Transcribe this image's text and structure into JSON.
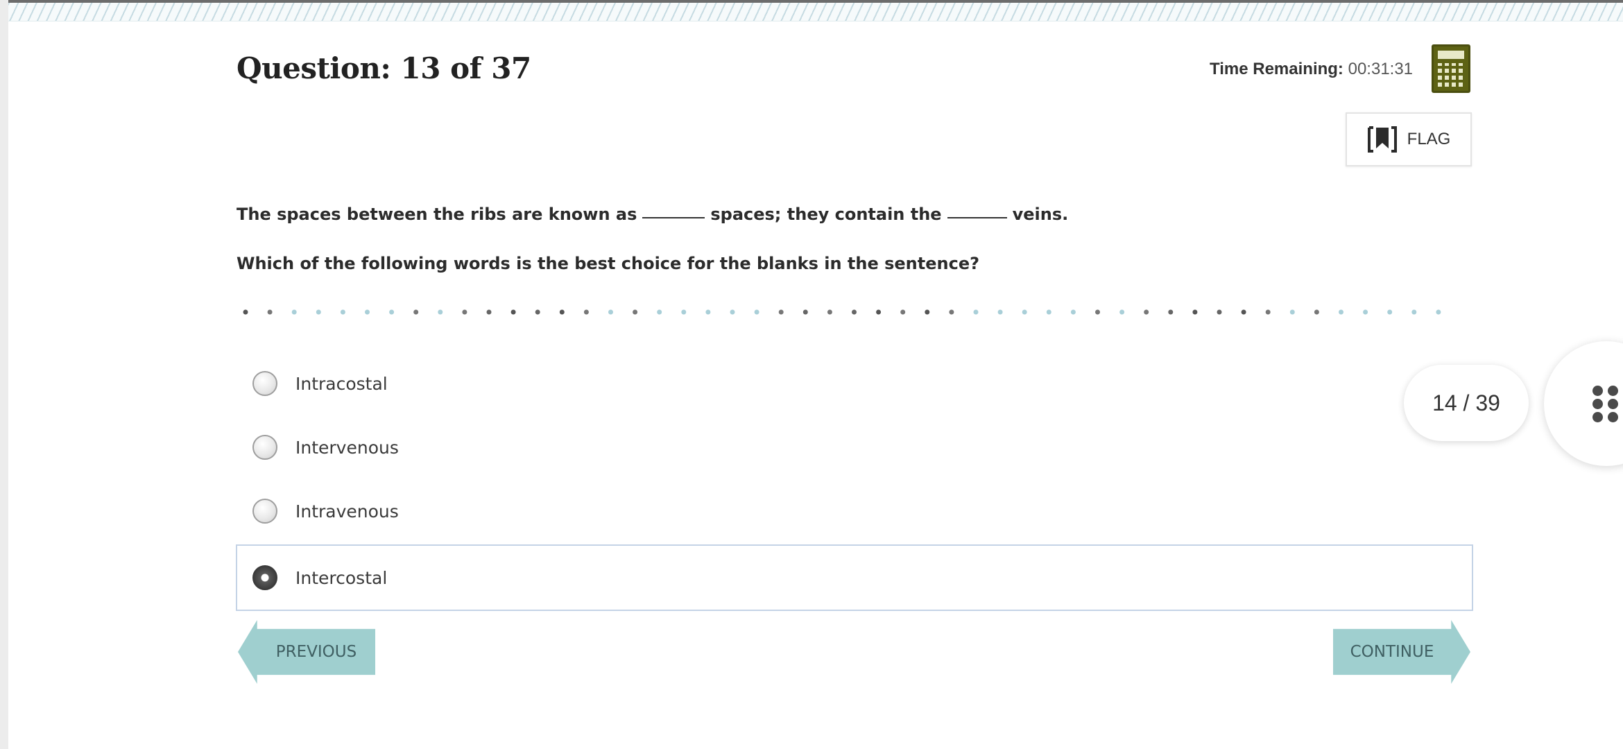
{
  "header": {
    "question_title": "Question: 13 of 37",
    "time_label": "Time Remaining:",
    "time_value": "00:31:31",
    "calculator_icon": "calculator-icon",
    "flag": {
      "label": "FLAG",
      "icon": "bookmark-flag-icon"
    }
  },
  "question": {
    "sentence_part1": "The spaces between the ribs are known as",
    "sentence_part2": "spaces; they contain the",
    "sentence_part3": "veins.",
    "prompt": "Which of the following words is the best choice for the blanks in the sentence?"
  },
  "options": [
    {
      "label": "Intracostal",
      "selected": false
    },
    {
      "label": "Intervenous",
      "selected": false
    },
    {
      "label": "Intravenous",
      "selected": false
    },
    {
      "label": "Intercostal",
      "selected": true
    }
  ],
  "navigation": {
    "previous": "PREVIOUS",
    "continue": "CONTINUE"
  },
  "viewer": {
    "page_indicator": "14 / 39",
    "grid_icon": "grid-dots-icon"
  },
  "colors": {
    "accent_teal": "#9fcfcf",
    "calculator_olive": "#5d6214",
    "selected_border": "#c4d3e6"
  }
}
